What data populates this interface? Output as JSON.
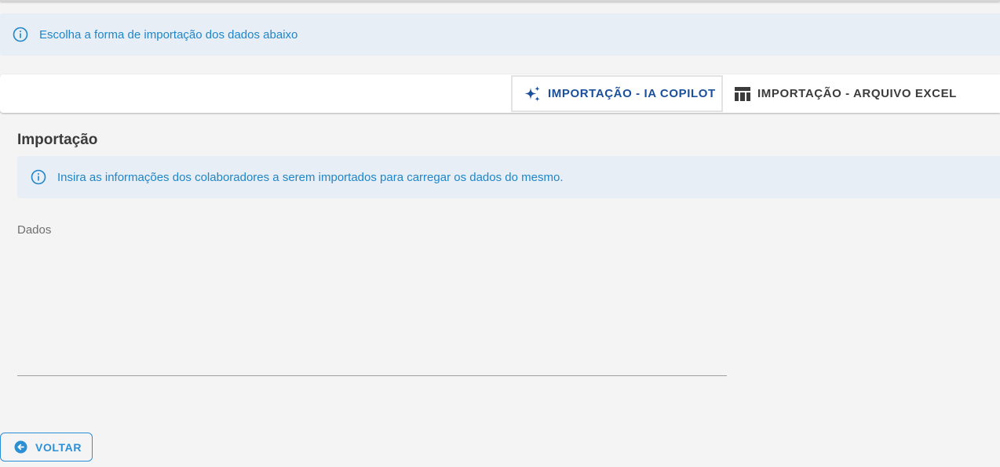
{
  "top_info": {
    "text": "Escolha a forma de importação dos dados abaixo",
    "icon": "info-icon"
  },
  "tabs": [
    {
      "label": "IMPORTAÇÃO - IA COPILOT",
      "icon": "sparkle-icon",
      "active": true
    },
    {
      "label": "IMPORTAÇÃO - ARQUIVO EXCEL",
      "icon": "table-icon",
      "active": false
    }
  ],
  "section": {
    "title": "Importação",
    "info": {
      "text": "Insira as informações dos colaboradores a serem importados para carregar os dados do mesmo.",
      "icon": "info-icon"
    },
    "field": {
      "label": "Dados",
      "value": ""
    }
  },
  "back_button": {
    "label": "VOLTAR",
    "icon": "arrow-left-circle-icon"
  },
  "colors": {
    "info_text": "#1f86c9",
    "info_bg": "#e7eef5",
    "active_tab": "#1a4f9c",
    "primary": "#2c8fd6"
  }
}
